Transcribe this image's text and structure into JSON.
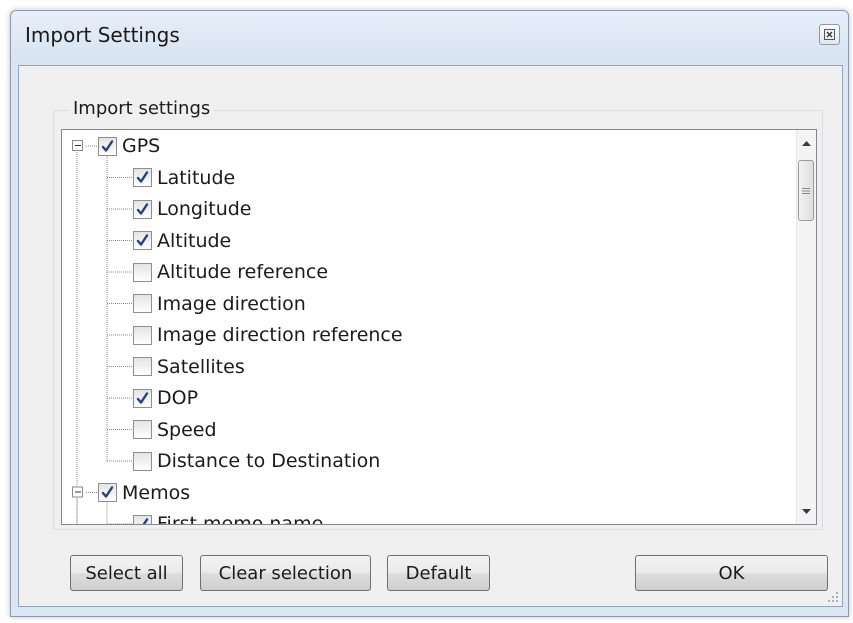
{
  "window": {
    "title": "Import Settings"
  },
  "group": {
    "label": "Import settings"
  },
  "tree": {
    "nodes": [
      {
        "label": "GPS",
        "checked": true,
        "level": 0,
        "expanded": true
      },
      {
        "label": "Latitude",
        "checked": true,
        "level": 1
      },
      {
        "label": "Longitude",
        "checked": true,
        "level": 1
      },
      {
        "label": "Altitude",
        "checked": true,
        "level": 1
      },
      {
        "label": "Altitude reference",
        "checked": false,
        "level": 1
      },
      {
        "label": "Image direction",
        "checked": false,
        "level": 1
      },
      {
        "label": "Image direction reference",
        "checked": false,
        "level": 1
      },
      {
        "label": "Satellites",
        "checked": false,
        "level": 1
      },
      {
        "label": "DOP",
        "checked": true,
        "level": 1
      },
      {
        "label": "Speed",
        "checked": false,
        "level": 1
      },
      {
        "label": "Distance to Destination",
        "checked": false,
        "level": 1
      },
      {
        "label": "Memos",
        "checked": true,
        "level": 0,
        "expanded": true
      },
      {
        "label": "First memo name",
        "checked": true,
        "level": 1
      }
    ]
  },
  "buttons": {
    "select_all": "Select all",
    "clear_selection": "Clear selection",
    "default": "Default",
    "ok": "OK"
  },
  "icons": {
    "close": "close-icon",
    "checkbox_checked": "checkmark-icon",
    "expander": "collapse-minus-icon",
    "scroll_up": "arrow-up-icon",
    "scroll_down": "arrow-down-icon",
    "resize_grip": "resize-grip-icon"
  },
  "colors": {
    "window_frame": "#dbe6f3",
    "client_background": "#f0f0f0",
    "check_color": "#1f3f8f",
    "tree_border": "#828790"
  }
}
